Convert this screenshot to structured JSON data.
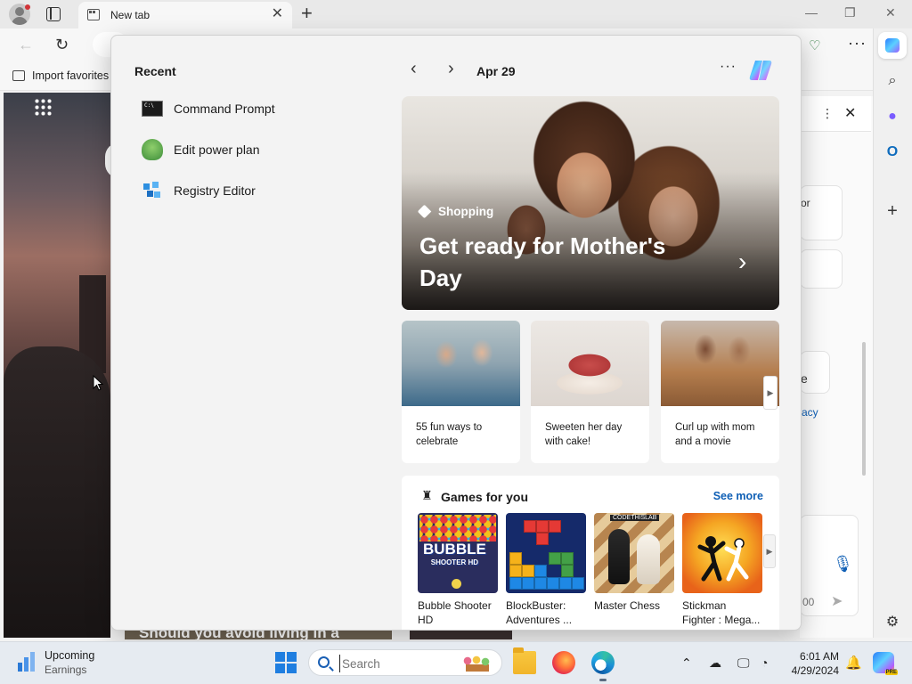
{
  "browser": {
    "tab_title": "New tab",
    "favorites_import": "Import favorites"
  },
  "start_menu": {
    "recent_title": "Recent",
    "recent_items": [
      {
        "label": "Command Prompt",
        "icon": "command-prompt-icon"
      },
      {
        "label": "Edit power plan",
        "icon": "power-plan-icon"
      },
      {
        "label": "Registry Editor",
        "icon": "registry-editor-icon"
      }
    ],
    "date": "Apr 29",
    "hero": {
      "category": "Shopping",
      "title": "Get ready for Mother's Day"
    },
    "cards": [
      {
        "caption": "55 fun ways to celebrate"
      },
      {
        "caption": "Sweeten her day with cake!"
      },
      {
        "caption": "Curl up with mom and a movie"
      }
    ],
    "games": {
      "title": "Games for you",
      "see_more": "See more",
      "items": [
        {
          "name": "Bubble Shooter HD",
          "logo_text": "BUBBLE SHOOTER HD"
        },
        {
          "name": "BlockBuster: Adventures ..."
        },
        {
          "name": "Master Chess",
          "badge": "CODETHISLAB"
        },
        {
          "name": "Stickman Fighter : Mega..."
        }
      ]
    }
  },
  "background_page": {
    "right_panel_texts": [
      "or",
      "e",
      "acy",
      "00"
    ],
    "bottom_headline": "Should you avoid living in a"
  },
  "taskbar": {
    "widget_title": "Upcoming",
    "widget_subtitle": "Earnings",
    "search_placeholder": "Search",
    "time": "6:01 AM",
    "date": "4/29/2024",
    "copilot_badge": "PRE"
  },
  "colors": {
    "accent_blue": "#0f5fb5",
    "windows_blue": "#1f7ee0",
    "taskbar_bg": "#e6ebf1"
  }
}
